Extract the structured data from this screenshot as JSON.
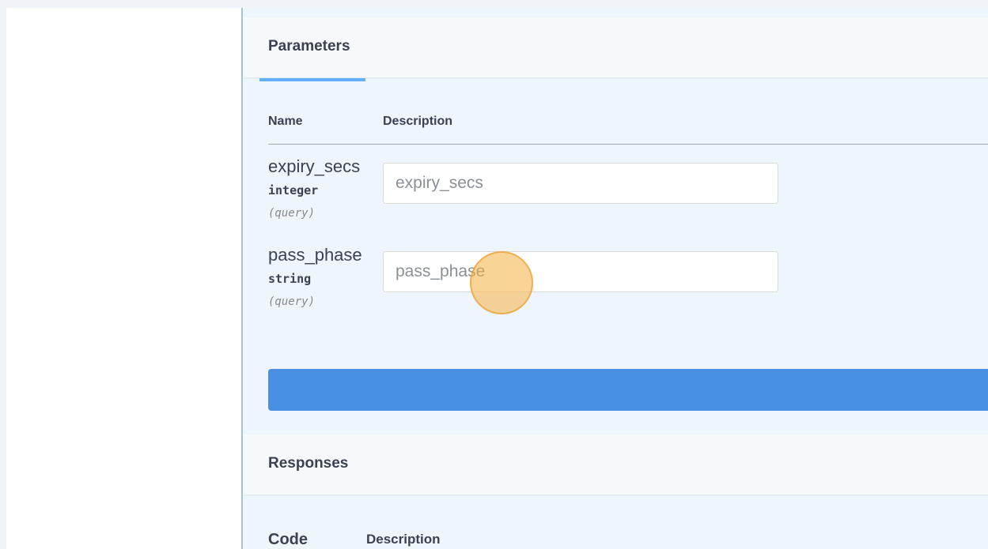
{
  "parameters": {
    "tab_label": "Parameters",
    "col_name": "Name",
    "col_description": "Description",
    "items": [
      {
        "name": "expiry_secs",
        "type": "integer",
        "in": "(query)",
        "placeholder": "expiry_secs",
        "value": ""
      },
      {
        "name": "pass_phase",
        "type": "string",
        "in": "(query)",
        "placeholder": "pass_phase",
        "value": ""
      }
    ]
  },
  "execute": {
    "label": ""
  },
  "responses": {
    "title": "Responses",
    "col_code": "Code",
    "col_description": "Description"
  },
  "colors": {
    "accent": "#61affe",
    "button": "#4990e2",
    "click_marker": "#f6b042"
  }
}
